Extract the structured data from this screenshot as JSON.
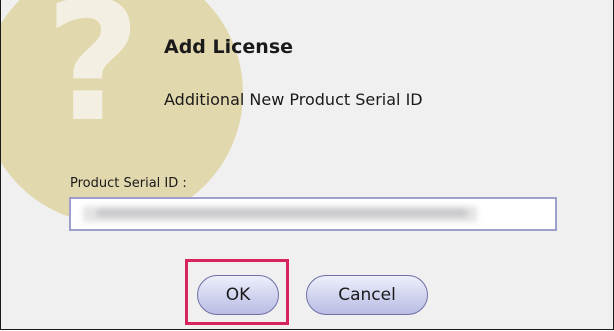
{
  "dialog": {
    "icon": "question-mark-icon",
    "title": "Add License",
    "subtitle": "Additional New Product Serial ID",
    "field_label": "Product Serial ID :",
    "serial_value_redacted": true,
    "ok_label": "OK",
    "cancel_label": "Cancel",
    "highlighted_button": "OK"
  },
  "colors": {
    "dialog_background": "#f0f0f0",
    "watermark_circle": "#e2d8ad",
    "input_border": "#9e9ecf",
    "highlight_border": "#d6245c",
    "button_border": "#6f6fa6"
  }
}
